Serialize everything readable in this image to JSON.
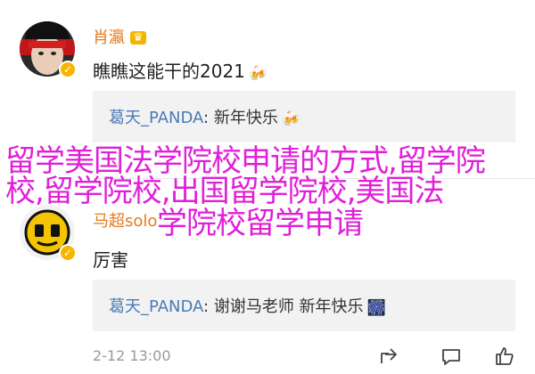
{
  "comments": [
    {
      "username": "肖瀛",
      "vip_label": "♛",
      "text": "瞧瞧这能干的2021",
      "text_emoji": "🍻",
      "reply": {
        "user": "葛天_PANDA",
        "sep": ": ",
        "text": "新年快乐",
        "emoji": "🍻"
      }
    },
    {
      "username": "马超solo",
      "text": "厉害",
      "reply": {
        "user": "葛天_PANDA",
        "sep": ": ",
        "text": "谢谢马老师 新年快乐",
        "emoji": "🎆"
      }
    }
  ],
  "meta": {
    "date": "2-12 13:00"
  },
  "overlay": {
    "line1": "留学美国法学院校申请的方式,留学院",
    "line2": "校,留学院校,出国留学院校,美国法",
    "line3": "学院校留学申请"
  },
  "icons": {
    "verified": "verified-badge-icon",
    "share": "share-icon",
    "comment": "comment-icon",
    "like": "thumbs-up-icon"
  },
  "colors": {
    "username": "#e57a1b",
    "reply_user": "#4a7ab5",
    "overlay": "#e020d8",
    "badge": "#f7b500"
  }
}
